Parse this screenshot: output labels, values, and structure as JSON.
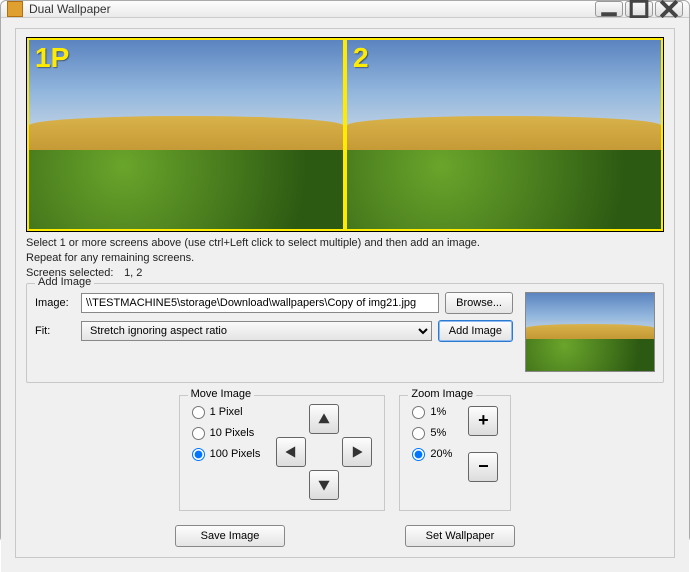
{
  "window": {
    "title": "Dual Wallpaper"
  },
  "screens": [
    {
      "label": "1P"
    },
    {
      "label": "2"
    }
  ],
  "instructions": {
    "line1": "Select 1 or more screens above (use ctrl+Left click to select multiple) and then add an image.",
    "line2": "Repeat for any remaining screens.",
    "selected_label": "Screens selected:",
    "selected_value": "1, 2"
  },
  "add_image": {
    "legend": "Add Image",
    "image_label": "Image:",
    "image_path": "\\\\TESTMACHINE5\\storage\\Download\\wallpapers\\Copy of img21.jpg",
    "browse_label": "Browse...",
    "fit_label": "Fit:",
    "fit_value": "Stretch ignoring aspect ratio",
    "add_label": "Add Image"
  },
  "move": {
    "legend": "Move Image",
    "options": [
      {
        "label": "1 Pixel",
        "checked": false
      },
      {
        "label": "10 Pixels",
        "checked": false
      },
      {
        "label": "100 Pixels",
        "checked": true
      }
    ]
  },
  "zoom": {
    "legend": "Zoom Image",
    "options": [
      {
        "label": "1%",
        "checked": false
      },
      {
        "label": "5%",
        "checked": false
      },
      {
        "label": "20%",
        "checked": true
      }
    ],
    "plus": "+",
    "minus": "−"
  },
  "buttons": {
    "save": "Save Image",
    "set": "Set Wallpaper"
  }
}
